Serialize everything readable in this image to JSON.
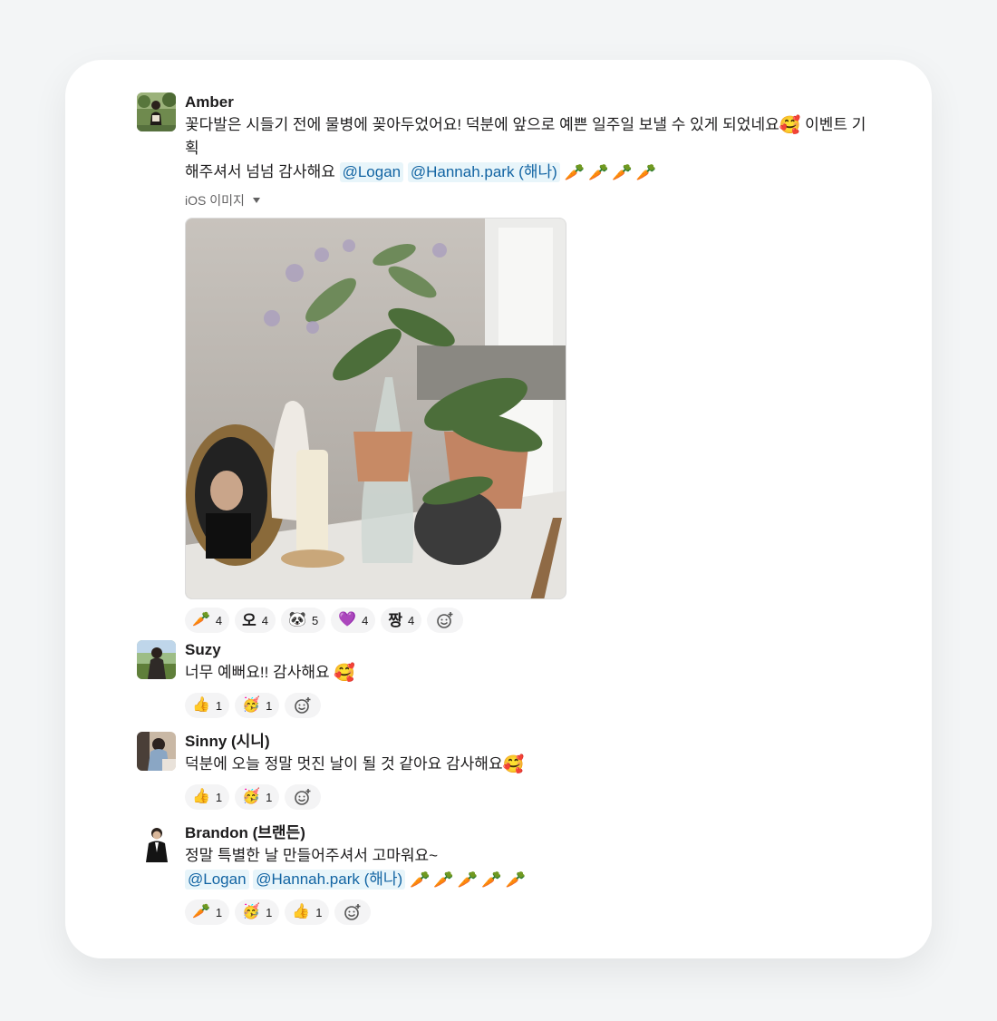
{
  "messages": [
    {
      "name": "Amber",
      "text_line1": "꽃다발은 시들기 전에 물병에 꽂아두었어요! 덕분에 앞으로 예쁜 일주일 보낼 수 있게 되었네요",
      "emoji_smile": "🥰",
      "text_line1_end": " 이벤트 기획",
      "text_line2": "해주셔서 넘넘 감사해요 ",
      "mention1": "@Logan",
      "mention2": "@Hannah.park (해나)",
      "carrot": "🥕",
      "attachment_label": "iOS 이미지",
      "reactions": [
        {
          "emoji": "🥕",
          "count": "4"
        },
        {
          "emoji": "오",
          "count": "4"
        },
        {
          "emoji": "🐼",
          "count": "5"
        },
        {
          "emoji": "💜",
          "count": "4"
        },
        {
          "emoji": "짱",
          "count": "4"
        }
      ]
    },
    {
      "name": "Suzy",
      "text": "너무 예뻐요!! 감사해요 ",
      "emoji": "🥰",
      "reactions": [
        {
          "emoji": "👍",
          "count": "1"
        },
        {
          "emoji": "🥳",
          "count": "1"
        }
      ]
    },
    {
      "name": "Sinny (시니)",
      "text": "덕분에 오늘 정말 멋진 날이 될 것 같아요 감사해요",
      "emoji": "🥰",
      "reactions": [
        {
          "emoji": "👍",
          "count": "1"
        },
        {
          "emoji": "🥳",
          "count": "1"
        }
      ]
    },
    {
      "name": "Brandon (브랜든)",
      "text": "정말 특별한 날 만들어주셔서 고마워요~",
      "mention1": "@Logan",
      "mention2": "@Hannah.park (해나)",
      "carrot": "🥕",
      "reactions": [
        {
          "emoji": "🥕",
          "count": "1"
        },
        {
          "emoji": "🥳",
          "count": "1"
        },
        {
          "emoji": "👍",
          "count": "1"
        }
      ]
    }
  ],
  "icons": {
    "add_reaction": "add-reaction-icon",
    "caret": "caret-down-icon"
  },
  "colors": {
    "mention_text": "#1264a3",
    "mention_bg": "#e8f5fa",
    "reaction_bg": "#f4f4f5",
    "page_bg": "#f3f5f6"
  }
}
